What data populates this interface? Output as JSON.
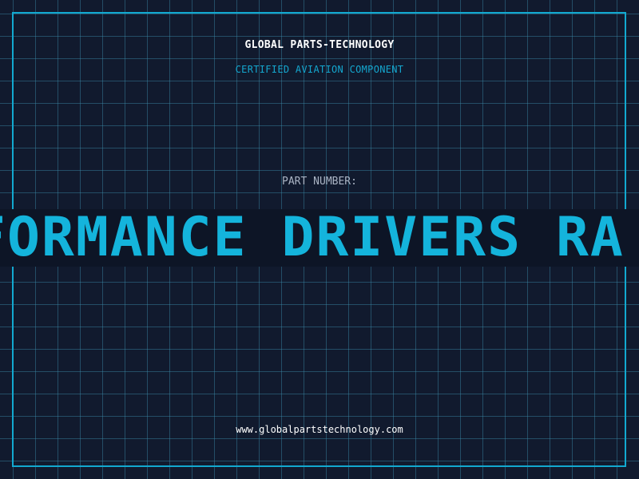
{
  "header": {
    "brand": "GLOBAL PARTS-TECHNOLOGY",
    "subtitle": "CERTIFIED AVIATION COMPONENT"
  },
  "part": {
    "label": "PART NUMBER:",
    "number": "FORMANCE DRIVERS RA"
  },
  "footer": {
    "url": "www.globalpartstechnology.com"
  },
  "colors": {
    "background": "#111a2e",
    "accent": "#12a9d0",
    "grid": "#3c8caa",
    "text": "#ffffff"
  }
}
